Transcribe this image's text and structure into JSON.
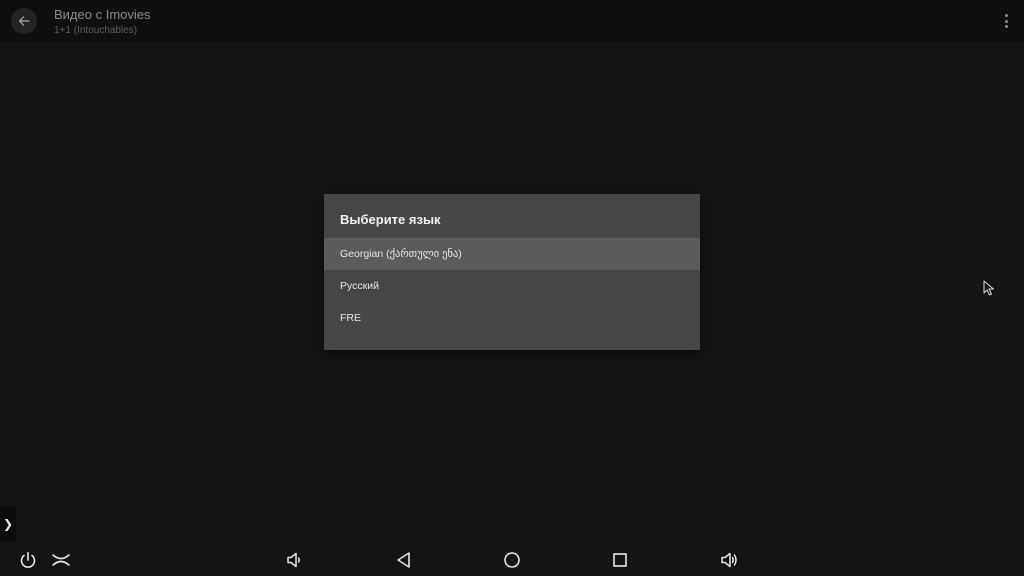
{
  "appbar": {
    "title": "Видео с Imovies",
    "subtitle": "1+1 (Intouchables)",
    "back_icon": "arrow-left-icon",
    "menu_icon": "more-vertical-icon"
  },
  "dialog": {
    "title": "Выберите язык",
    "options": [
      {
        "label": "Georgian (ქართული ენა)",
        "selected": true
      },
      {
        "label": "Русский",
        "selected": false
      },
      {
        "label": "FRE",
        "selected": false
      }
    ]
  },
  "drawer": {
    "handle_label": "❯"
  },
  "navbar": {
    "buttons": [
      "power-icon",
      "collapse-icon",
      "volume-down-icon",
      "back-triangle-icon",
      "home-circle-icon",
      "recents-square-icon",
      "volume-up-icon"
    ]
  },
  "colors": {
    "background": "#141414",
    "dialog": "#464646",
    "selected_row": "#5b5b5b"
  }
}
